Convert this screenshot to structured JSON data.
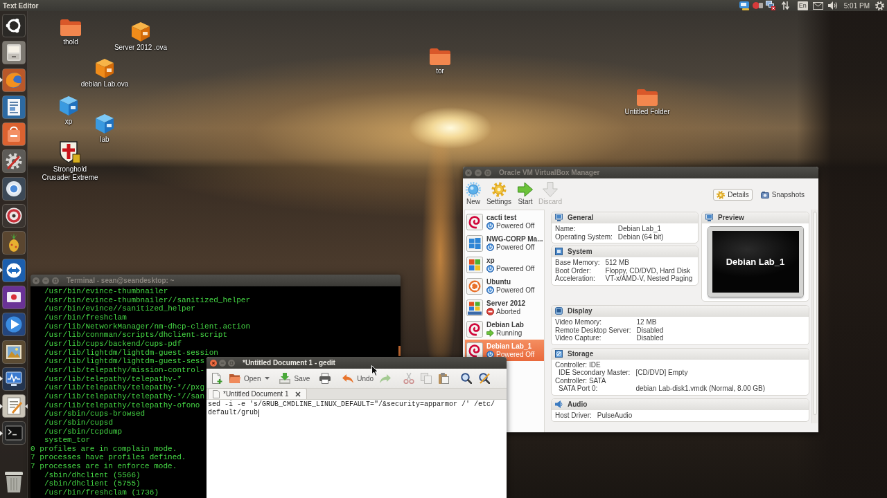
{
  "top_panel": {
    "app_title": "Text Editor",
    "keyboard_layout": "En",
    "clock": "5:01 PM"
  },
  "launcher": [
    {
      "kind": "home",
      "running": false,
      "focused": false
    },
    {
      "kind": "files",
      "running": false,
      "focused": false
    },
    {
      "kind": "browser",
      "running": true,
      "focused": false
    },
    {
      "kind": "document",
      "running": false,
      "focused": false
    },
    {
      "kind": "store",
      "running": false,
      "focused": false
    },
    {
      "kind": "settings",
      "running": false,
      "focused": false
    },
    {
      "kind": "web",
      "running": false,
      "focused": false
    },
    {
      "kind": "disc",
      "running": false,
      "focused": false
    },
    {
      "kind": "fruit",
      "running": false,
      "focused": false
    },
    {
      "kind": "remote",
      "running": true,
      "focused": false
    },
    {
      "kind": "recorder",
      "running": false,
      "focused": false
    },
    {
      "kind": "player",
      "running": false,
      "focused": false
    },
    {
      "kind": "photos",
      "running": false,
      "focused": false
    },
    {
      "kind": "monitor",
      "running": true,
      "focused": false
    },
    {
      "kind": "editor",
      "running": true,
      "focused": true
    },
    {
      "kind": "terminal",
      "running": true,
      "focused": false
    },
    {
      "kind": "trash",
      "running": false,
      "focused": false
    }
  ],
  "desktop_icons": [
    {
      "kind": "folder",
      "label": "thold"
    },
    {
      "kind": "package",
      "label": "Server 2012 .ova"
    },
    {
      "kind": "package",
      "label": "debian Lab.ova"
    },
    {
      "kind": "disk",
      "label": "xp"
    },
    {
      "kind": "disk",
      "label": "lab"
    },
    {
      "kind": "game",
      "label": "Stronghold Crusader Extreme"
    },
    {
      "kind": "folder",
      "label": "tor"
    },
    {
      "kind": "folder",
      "label": "Untitled Folder"
    }
  ],
  "terminal": {
    "title": "Terminal - sean@seandesktop: ~",
    "active": false,
    "lines": [
      {
        "text": "/usr/bin/evince-thumbnailer",
        "indented": true
      },
      {
        "text": "/usr/bin/evince-thumbnailer//sanitized_helper",
        "indented": true
      },
      {
        "text": "/usr/bin/evince//sanitized_helper",
        "indented": true
      },
      {
        "text": "/usr/bin/freshclam",
        "indented": true
      },
      {
        "text": "/usr/lib/NetworkManager/nm-dhcp-client.action",
        "indented": true
      },
      {
        "text": "/usr/lib/connman/scripts/dhclient-script",
        "indented": true
      },
      {
        "text": "/usr/lib/cups/backend/cups-pdf",
        "indented": true
      },
      {
        "text": "/usr/lib/lightdm/lightdm-guest-session",
        "indented": true
      },
      {
        "text": "/usr/lib/lightdm/lightdm-guest-sess",
        "indented": true
      },
      {
        "text": "/usr/lib/telepathy/mission-control-",
        "indented": true
      },
      {
        "text": "/usr/lib/telepathy/telepathy-*",
        "indented": true
      },
      {
        "text": "/usr/lib/telepathy/telepathy-*//pxg",
        "indented": true
      },
      {
        "text": "/usr/lib/telepathy/telepathy-*//san",
        "indented": true
      },
      {
        "text": "/usr/lib/telepathy/telepathy-ofono",
        "indented": true
      },
      {
        "text": "/usr/sbin/cups-browsed",
        "indented": true
      },
      {
        "text": "/usr/sbin/cupsd",
        "indented": true
      },
      {
        "text": "/usr/sbin/tcpdump",
        "indented": true
      },
      {
        "text": "system_tor",
        "indented": true
      },
      {
        "text": "0 profiles are in complain mode.",
        "indented": false
      },
      {
        "text": "7 processes have profiles defined.",
        "indented": false
      },
      {
        "text": "7 processes are in enforce mode.",
        "indented": false
      },
      {
        "text": "/sbin/dhclient (5566)",
        "indented": true
      },
      {
        "text": "/sbin/dhclient (5755)",
        "indented": true
      },
      {
        "text": "/usr/bin/freshclam (1736)",
        "indented": true
      }
    ]
  },
  "gedit": {
    "title": "*Untitled Document 1 - gedit",
    "active": true,
    "toolbar": [
      {
        "kind": "new",
        "disabled": false
      },
      {
        "kind": "open",
        "label": "Open",
        "disabled": false
      },
      {
        "kind": "open-menu",
        "disabled": false
      },
      {
        "kind": "save",
        "label": "Save",
        "disabled": false
      },
      {
        "kind": "print",
        "disabled": false
      },
      {
        "kind": "undo",
        "label": "Undo",
        "disabled": false
      },
      {
        "kind": "redo",
        "disabled": true
      },
      {
        "kind": "cut",
        "disabled": true
      },
      {
        "kind": "copy",
        "disabled": true
      },
      {
        "kind": "paste",
        "disabled": false
      },
      {
        "kind": "find",
        "disabled": false
      },
      {
        "kind": "replace",
        "disabled": false
      }
    ],
    "tabs": [
      {
        "label": "*Untitled Document 1",
        "selected": true
      }
    ],
    "content_lines": [
      "sed -i -e 's/GRUB_CMDLINE_LINUX_DEFAULT=\"/&security=apparmor /' /etc/",
      "default/grub"
    ]
  },
  "virtualbox": {
    "title": "Oracle VM VirtualBox Manager",
    "active": false,
    "toolbar": [
      {
        "kind": "new",
        "label": "New",
        "disabled": false
      },
      {
        "kind": "settings",
        "label": "Settings",
        "disabled": false
      },
      {
        "kind": "start",
        "label": "Start",
        "disabled": false
      },
      {
        "kind": "discard",
        "label": "Discard",
        "disabled": true
      }
    ],
    "view_modes": [
      {
        "kind": "details",
        "label": "Details",
        "selected": true
      },
      {
        "kind": "snapshots",
        "label": "Snapshots",
        "selected": false
      }
    ],
    "machines": [
      {
        "name": "cacti test",
        "kind": "debian",
        "status": {
          "kind": "off",
          "text": "Powered Off"
        },
        "selected": false
      },
      {
        "name": "NWG-CORP Ma...",
        "kind": "windows8",
        "status": {
          "kind": "off",
          "text": "Powered Off"
        },
        "selected": false
      },
      {
        "name": "xp",
        "kind": "xp",
        "status": {
          "kind": "off",
          "text": "Powered Off"
        },
        "selected": false
      },
      {
        "name": "Ubuntu",
        "kind": "ubuntu",
        "status": {
          "kind": "off",
          "text": "Powered Off"
        },
        "selected": false
      },
      {
        "name": "Server 2012",
        "kind": "server",
        "status": {
          "kind": "aborted",
          "text": "Aborted"
        },
        "selected": false
      },
      {
        "name": "Debian Lab",
        "kind": "debian",
        "status": {
          "kind": "running",
          "text": "Running"
        },
        "selected": false
      },
      {
        "name": "Debian Lab_1",
        "kind": "debian",
        "status": {
          "kind": "off",
          "text": "Powered Off"
        },
        "selected": true
      }
    ],
    "details": [
      {
        "kind": "general",
        "title": "General",
        "rows": [
          {
            "label": "Name:",
            "value": "Debian Lab_1"
          },
          {
            "label": "Operating System:",
            "value": "Debian (64 bit)"
          }
        ]
      },
      {
        "kind": "preview",
        "title": "Preview",
        "screen_text": "Debian Lab_1"
      },
      {
        "kind": "system",
        "title": "System",
        "rows": [
          {
            "label": "Base Memory:",
            "value": "512 MB"
          },
          {
            "label": "Boot Order:",
            "value": "Floppy, CD/DVD, Hard Disk"
          },
          {
            "label": "Acceleration:",
            "value": "VT-x/AMD-V, Nested Paging"
          }
        ]
      },
      {
        "kind": "display",
        "title": "Display",
        "rows": [
          {
            "label": "Video Memory:",
            "value": "12 MB"
          },
          {
            "label": "Remote Desktop Server:",
            "value": "Disabled"
          },
          {
            "label": "Video Capture:",
            "value": "Disabled"
          }
        ]
      },
      {
        "kind": "storage",
        "title": "Storage",
        "rows": [
          {
            "label": "Controller: IDE",
            "children": [
              {
                "label": "IDE Secondary Master:",
                "value": "[CD/DVD] Empty"
              }
            ]
          },
          {
            "label": "Controller: SATA",
            "children": [
              {
                "label": "SATA Port 0:",
                "value": "debian Lab-disk1.vmdk (Normal, 8.00 GB)"
              }
            ]
          }
        ]
      },
      {
        "kind": "audio",
        "title": "Audio",
        "rows": [
          {
            "label": "Host Driver:",
            "value": "PulseAudio"
          }
        ]
      }
    ]
  }
}
